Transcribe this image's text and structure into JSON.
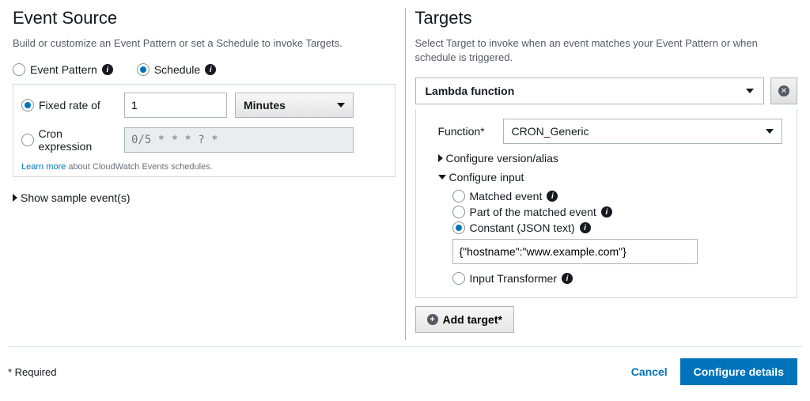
{
  "eventSource": {
    "title": "Event Source",
    "description": "Build or customize an Event Pattern or set a Schedule to invoke Targets.",
    "tabs": {
      "pattern": "Event Pattern",
      "schedule": "Schedule"
    },
    "fixedRateLabel": "Fixed rate of",
    "fixedRateValue": "1",
    "unit": "Minutes",
    "cronLabel": "Cron expression",
    "cronPlaceholder": "0/5 * * * ? *",
    "learnLink": "Learn more",
    "learnText": " about CloudWatch Events schedules.",
    "showSample": "Show sample event(s)"
  },
  "targets": {
    "title": "Targets",
    "description": "Select Target to invoke when an event matches your Event Pattern or when schedule is triggered.",
    "type": "Lambda function",
    "functionLabel": "Function*",
    "functionValue": "CRON_Generic",
    "configVersion": "Configure version/alias",
    "configInput": "Configure input",
    "inputOptions": {
      "matched": "Matched event",
      "part": "Part of the matched event",
      "constant": "Constant (JSON text)",
      "transformer": "Input Transformer"
    },
    "jsonValue": "{\"hostname\":\"www.example.com\"}",
    "addTarget": "Add target*"
  },
  "footer": {
    "required": "* Required",
    "cancel": "Cancel",
    "primary": "Configure details"
  }
}
